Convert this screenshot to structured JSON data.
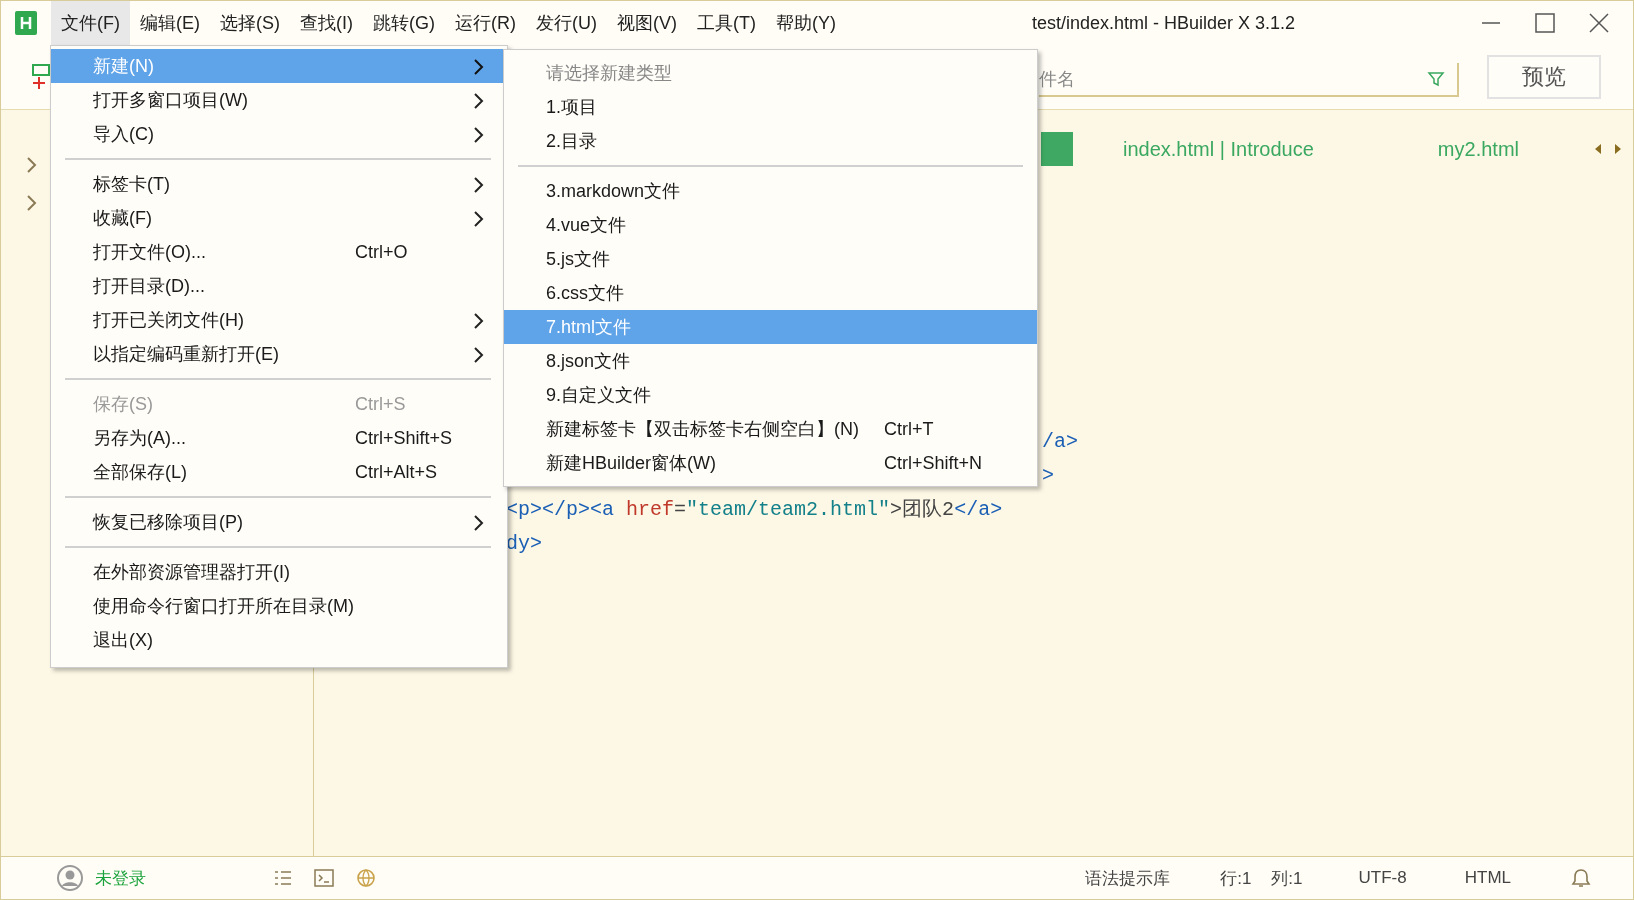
{
  "window": {
    "title": "test/index.html - HBuilder X 3.1.2"
  },
  "menubar": [
    {
      "label": "文件(F)",
      "selected": true
    },
    {
      "label": "编辑(E)",
      "selected": false
    },
    {
      "label": "选择(S)",
      "selected": false
    },
    {
      "label": "查找(I)",
      "selected": false
    },
    {
      "label": "跳转(G)",
      "selected": false
    },
    {
      "label": "运行(R)",
      "selected": false
    },
    {
      "label": "发行(U)",
      "selected": false
    },
    {
      "label": "视图(V)",
      "selected": false
    },
    {
      "label": "工具(T)",
      "selected": false
    },
    {
      "label": "帮助(Y)",
      "selected": false
    }
  ],
  "toolbar": {
    "search": {
      "placeholder": "件名"
    },
    "preview_button": "预览"
  },
  "editor": {
    "tabs": [
      {
        "selected": true
      },
      {
        "label": "index.html | Introduce",
        "selected": false
      },
      {
        "label": "my2.html",
        "selected": false
      }
    ],
    "lines": [
      {
        "kind": "fragment",
        "tokens": [
          {
            "kind": "tag",
            "text": "/a>"
          }
        ]
      },
      {
        "kind": "fragment",
        "tokens": [
          {
            "kind": "tag",
            "text": ">"
          }
        ]
      },
      {
        "kind": "full",
        "tokens": [
          {
            "kind": "tag",
            "text": "<p></p><a "
          },
          {
            "kind": "attr",
            "text": "href"
          },
          {
            "kind": "plain",
            "text": "="
          },
          {
            "kind": "string",
            "text": "\"team/team2.html\""
          },
          {
            "kind": "plain",
            "text": ">团队2"
          },
          {
            "kind": "tag",
            "text": "</a>"
          }
        ]
      },
      {
        "kind": "full",
        "tokens": [
          {
            "kind": "tag",
            "text": "dy>"
          }
        ]
      }
    ]
  },
  "file_menu": [
    {
      "kind": "item",
      "label": "新建(N)",
      "submenu": true,
      "selected": true,
      "disabled": false
    },
    {
      "kind": "item",
      "label": "打开多窗口项目(W)",
      "submenu": true,
      "selected": false,
      "disabled": false
    },
    {
      "kind": "item",
      "label": "导入(C)",
      "submenu": true,
      "selected": false,
      "disabled": false
    },
    {
      "kind": "separator"
    },
    {
      "kind": "item",
      "label": "标签卡(T)",
      "submenu": true,
      "selected": false,
      "disabled": false
    },
    {
      "kind": "item",
      "label": "收藏(F)",
      "submenu": true,
      "selected": false,
      "disabled": false
    },
    {
      "kind": "item",
      "label": "打开文件(O)...",
      "shortcut": "Ctrl+O",
      "submenu": false,
      "selected": false,
      "disabled": false
    },
    {
      "kind": "item",
      "label": "打开目录(D)...",
      "submenu": false,
      "selected": false,
      "disabled": false
    },
    {
      "kind": "item",
      "label": "打开已关闭文件(H)",
      "submenu": true,
      "selected": false,
      "disabled": false
    },
    {
      "kind": "item",
      "label": "以指定编码重新打开(E)",
      "submenu": true,
      "selected": false,
      "disabled": false
    },
    {
      "kind": "separator"
    },
    {
      "kind": "item",
      "label": "保存(S)",
      "shortcut": "Ctrl+S",
      "submenu": false,
      "selected": false,
      "disabled": true
    },
    {
      "kind": "item",
      "label": "另存为(A)...",
      "shortcut": "Ctrl+Shift+S",
      "submenu": false,
      "selected": false,
      "disabled": false
    },
    {
      "kind": "item",
      "label": "全部保存(L)",
      "shortcut": "Ctrl+Alt+S",
      "submenu": false,
      "selected": false,
      "disabled": false
    },
    {
      "kind": "separator"
    },
    {
      "kind": "item",
      "label": "恢复已移除项目(P)",
      "submenu": true,
      "selected": false,
      "disabled": false
    },
    {
      "kind": "separator"
    },
    {
      "kind": "item",
      "label": "在外部资源管理器打开(I)",
      "submenu": false,
      "selected": false,
      "disabled": false
    },
    {
      "kind": "item",
      "label": "使用命令行窗口打开所在目录(M)",
      "submenu": false,
      "selected": false,
      "disabled": false
    },
    {
      "kind": "item",
      "label": "退出(X)",
      "submenu": false,
      "selected": false,
      "disabled": false
    }
  ],
  "new_submenu": [
    {
      "kind": "header",
      "label": "请选择新建类型"
    },
    {
      "kind": "item",
      "label": "1.项目",
      "selected": false
    },
    {
      "kind": "item",
      "label": "2.目录",
      "selected": false
    },
    {
      "kind": "separator"
    },
    {
      "kind": "item",
      "label": "3.markdown文件",
      "selected": false
    },
    {
      "kind": "item",
      "label": "4.vue文件",
      "selected": false
    },
    {
      "kind": "item",
      "label": "5.js文件",
      "selected": false
    },
    {
      "kind": "item",
      "label": "6.css文件",
      "selected": false
    },
    {
      "kind": "item",
      "label": "7.html文件",
      "selected": true
    },
    {
      "kind": "item",
      "label": "8.json文件",
      "selected": false
    },
    {
      "kind": "item",
      "label": "9.自定义文件",
      "selected": false
    },
    {
      "kind": "item",
      "label": "新建标签卡【双击标签卡右侧空白】(N)",
      "shortcut": "Ctrl+T",
      "selected": false
    },
    {
      "kind": "item",
      "label": "新建HBuilder窗体(W)",
      "shortcut": "Ctrl+Shift+N",
      "selected": false
    }
  ],
  "status_bar": {
    "login": "未登录",
    "items": [
      "语法提示库",
      "行:1",
      "列:1",
      "UTF-8",
      "HTML"
    ]
  }
}
